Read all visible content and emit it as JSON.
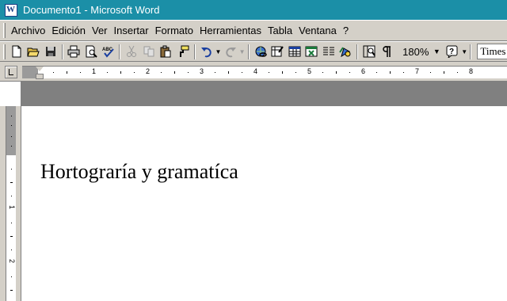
{
  "window": {
    "title": "Documento1 - Microsoft Word",
    "app_icon_letter": "W",
    "title_color": "#1b8fa7"
  },
  "menu": {
    "items": [
      "Archivo",
      "Edición",
      "Ver",
      "Insertar",
      "Formato",
      "Herramientas",
      "Tabla",
      "Ventana",
      "?"
    ]
  },
  "toolbar": {
    "buttons": [
      "new-document-icon",
      "open-folder-icon",
      "save-icon",
      "print-icon",
      "print-preview-icon",
      "spelling-check-icon",
      "cut-icon",
      "copy-icon",
      "paste-icon",
      "format-painter-icon",
      "undo-icon",
      "redo-icon",
      "hyperlink-icon",
      "tables-borders-icon",
      "insert-table-icon",
      "insert-excel-icon",
      "columns-icon",
      "drawing-icon",
      "document-map-icon",
      "show-formatting-icon",
      "help-icon"
    ],
    "zoom": "180%",
    "font_name": "Times New Roman"
  },
  "ruler": {
    "labels": [
      "1",
      "2",
      "3",
      "4",
      "5",
      "6",
      "7",
      "8"
    ]
  },
  "vruler": {
    "labels": [
      "1",
      "2"
    ]
  },
  "document": {
    "text": "Hortograría y gramatíca"
  }
}
